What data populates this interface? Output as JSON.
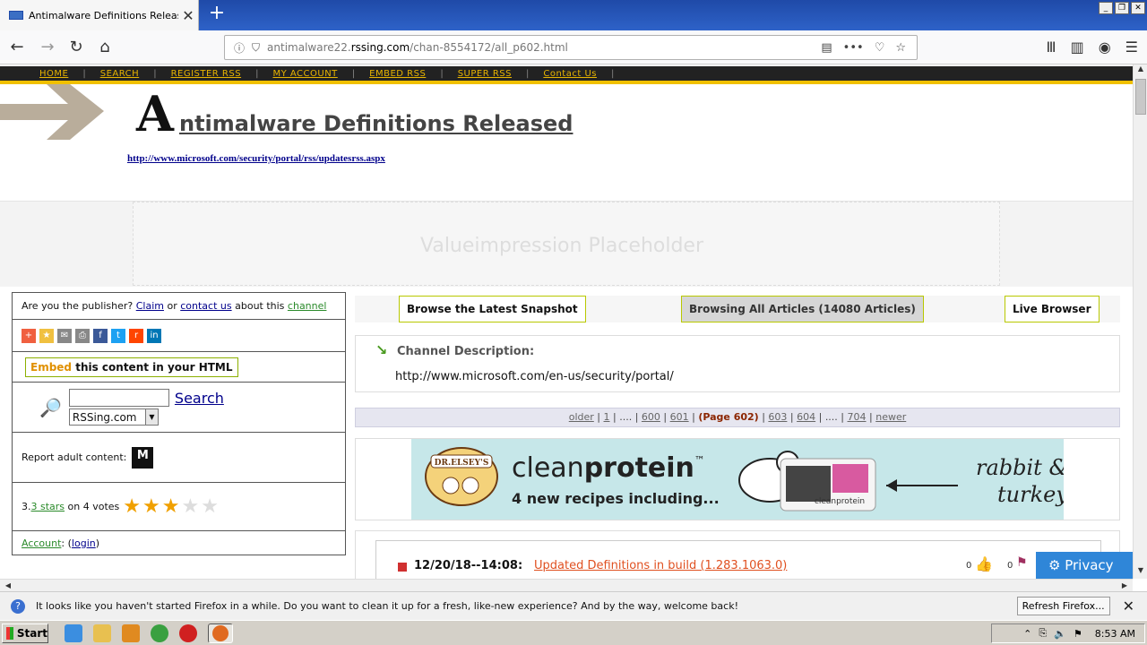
{
  "browser": {
    "tab_title": "Antimalware Definitions Released",
    "url_prefix": "antimalware22.",
    "url_domain": "rssing.com",
    "url_path": "/chan-8554172/all_p602.html"
  },
  "site_menu": [
    "HOME",
    "SEARCH",
    "REGISTER RSS",
    "MY ACCOUNT",
    "EMBED RSS",
    "SUPER RSS",
    "Contact Us"
  ],
  "header": {
    "big_letter": "A",
    "title_rest": "ntimalware Definitions Released",
    "feed_url": "http://www.microsoft.com/security/portal/rss/updatesrss.aspx"
  },
  "ad_placeholder": "Valueimpression Placeholder",
  "sidebar": {
    "publisher_q": "Are you the publisher?",
    "claim": "Claim",
    "or": "or",
    "contact_us": "contact us",
    "about_this": "about this",
    "channel": "channel",
    "embed_hl": "Embed",
    "embed_rest": " this content in your HTML",
    "search_label": "Search",
    "search_select": "RSSing.com",
    "report_adult": "Report adult content:",
    "mature_glyph": "M",
    "rating_prefix": "3.",
    "rating_link": "3 stars",
    "rating_suffix": "on 4 votes",
    "rating_value": 3.3,
    "rating_max": 5,
    "account_label": "Account",
    "login": "login"
  },
  "main": {
    "btn_latest": "Browse the Latest Snapshot",
    "btn_all": "Browsing All Articles (14080 Articles)",
    "btn_live": "Live Browser",
    "desc_label": "Channel Description:",
    "desc_url": "http://www.microsoft.com/en-us/security/portal/",
    "pager": {
      "older": "older",
      "p1": "1",
      "ellipsis": "....",
      "p600": "600",
      "p601": "601",
      "current": "(Page 602)",
      "p603": "603",
      "p604": "604",
      "p704": "704",
      "newer": "newer"
    },
    "banner": {
      "brand": "DR.ELSEY'S",
      "headline_light": "clean",
      "headline_bold": "protein",
      "tm": "™",
      "sub": "4 new recipes including...",
      "script": "rabbit &",
      "script2": "turkey",
      "can_label": "cleanprotein"
    },
    "article_date": "12/20/18--14:08:",
    "article_title": "Updated Definitions in build (1.283.1063.0)",
    "vote_up": "0",
    "vote_down": "0"
  },
  "privacy_label": "Privacy",
  "notification": {
    "message": "It looks like you haven't started Firefox in a while. Do you want to clean it up for a fresh, like-new experience? And by the way, welcome back!",
    "button": "Refresh Firefox..."
  },
  "taskbar": {
    "start": "Start",
    "clock": "8:53 AM"
  }
}
